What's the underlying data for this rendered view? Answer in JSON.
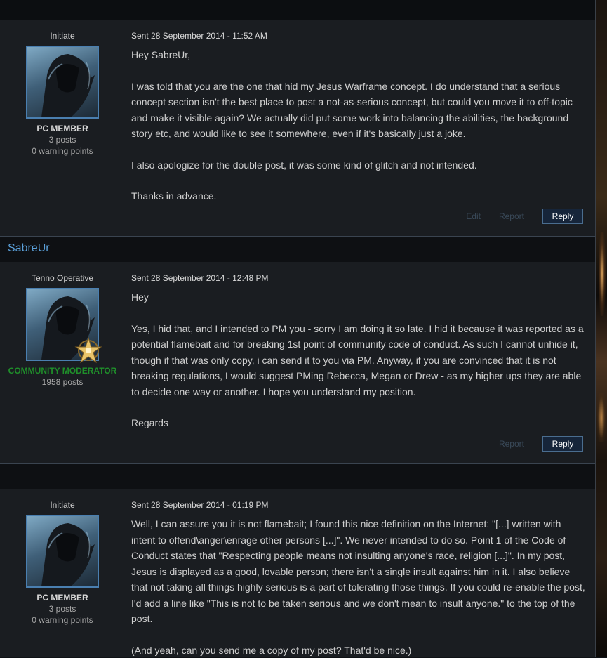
{
  "posts": [
    {
      "author_name": "",
      "rank": "Initiate",
      "group": "PC MEMBER",
      "posts_count": "3 posts",
      "warning": "0 warning points",
      "sent": "Sent 28 September 2014 - 11:52 AM",
      "paragraphs": [
        "Hey SabreUr,",
        "I was told that you are the one that hid my Jesus Warframe concept. I do understand that a serious concept section isn't the best place to post a not-as-serious concept, but could you move it to off-topic and make it visible again? We actually did put some work into balancing the abilities, the background story etc, and would like to see it somewhere, even if it's basically just a joke.",
        "I also apologize for the double post, it was some kind of glitch and not intended.",
        "Thanks in advance."
      ],
      "actions": {
        "edit": "Edit",
        "report": "Report",
        "reply": "Reply"
      }
    },
    {
      "author_name": "SabreUr",
      "rank": "Tenno Operative",
      "group": "COMMUNITY MODERATOR",
      "posts_count": "1958 posts",
      "sent": "Sent 28 September 2014 - 12:48 PM",
      "paragraphs": [
        "Hey",
        "Yes, I hid that, and I intended to PM you - sorry I am doing it so late. I hid it because it was reported as a potential flamebait and for breaking 1st point of community code of conduct. As such I cannot unhide it, though if that was only copy, i can send it to you via PM. Anyway, if you are convinced that it is not breaking regulations, I would suggest PMing Rebecca, Megan or Drew - as my higher ups they are able to decide one way or another. I hope you understand my position.",
        "Regards"
      ],
      "actions": {
        "report": "Report",
        "reply": "Reply"
      }
    },
    {
      "author_name": "",
      "rank": "Initiate",
      "group": "PC MEMBER",
      "posts_count": "3 posts",
      "warning": "0 warning points",
      "sent": "Sent 28 September 2014 - 01:19 PM",
      "paragraphs": [
        "Well, I can assure you it is not flamebait; I found this nice definition on the Internet: \"[...] written with intent to offend\\anger\\enrage other persons [...]\". We never intended to do so. Point 1 of the Code of Conduct states that \"Respecting people means not insulting anyone's race, religion [...]\". In my post, Jesus is displayed as a good, lovable person; there isn't a single insult against him in it. I also believe that not taking all things highly serious is a part of tolerating those things. If you could re-enable the post, I'd add a line like \"This is not to be taken serious and we don't mean to insult anyone.\" to the top of the post.",
        "(And yeah, can you send me a copy of my post? That'd be nice.)"
      ]
    }
  ],
  "colors": {
    "accent": "#5a9fd8",
    "moderator": "#1f8f2a",
    "background": "#1a1d21",
    "header": "#0e1013"
  },
  "icons": {
    "avatar": "warframe-helmet-avatar",
    "badge": "moderator-star-badge"
  }
}
